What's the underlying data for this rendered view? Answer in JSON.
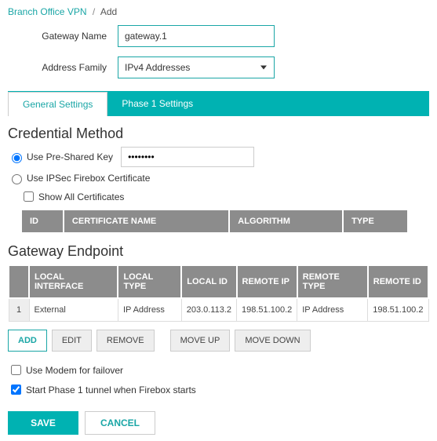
{
  "breadcrumb": {
    "parent": "Branch Office VPN",
    "current": "Add"
  },
  "form": {
    "gateway_name_label": "Gateway Name",
    "gateway_name_value": "gateway.1",
    "address_family_label": "Address Family",
    "address_family_value": "IPv4 Addresses"
  },
  "tabs": {
    "general": "General Settings",
    "phase1": "Phase 1 Settings",
    "active": "general"
  },
  "credential": {
    "title": "Credential Method",
    "psk_label": "Use Pre-Shared Key",
    "psk_value": "••••••••",
    "cert_label": "Use IPSec Firebox Certificate",
    "show_all_label": "Show All Certificates",
    "cert_headers": {
      "id": "ID",
      "name": "CERTIFICATE NAME",
      "algorithm": "ALGORITHM",
      "type": "TYPE"
    }
  },
  "endpoint": {
    "title": "Gateway Endpoint",
    "headers": {
      "idx": "",
      "local_interface": "LOCAL INTERFACE",
      "local_type": "LOCAL TYPE",
      "local_id": "LOCAL ID",
      "remote_ip": "REMOTE IP",
      "remote_type": "REMOTE TYPE",
      "remote_id": "REMOTE ID"
    },
    "rows": [
      {
        "idx": "1",
        "local_interface": "External",
        "local_type": "IP Address",
        "local_id": "203.0.113.2",
        "remote_ip": "198.51.100.2",
        "remote_type": "IP Address",
        "remote_id": "198.51.100.2"
      }
    ],
    "buttons": {
      "add": "ADD",
      "edit": "EDIT",
      "remove": "REMOVE",
      "move_up": "MOVE UP",
      "move_down": "MOVE DOWN"
    }
  },
  "options": {
    "modem_failover": "Use Modem for failover",
    "start_phase1": "Start Phase 1 tunnel when Firebox starts",
    "modem_failover_checked": false,
    "start_phase1_checked": true
  },
  "footer": {
    "save": "SAVE",
    "cancel": "CANCEL"
  }
}
